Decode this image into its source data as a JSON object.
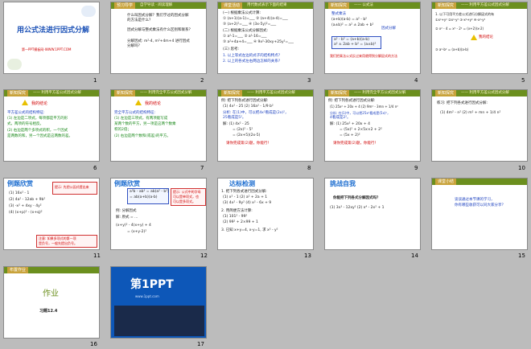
{
  "colors": {
    "accent": "#6b8f1e",
    "header_tab": "#c8a23a",
    "blue_slide": "#0d57b8",
    "title_blue": "#1f54b8",
    "red": "#d00000"
  },
  "slides": [
    {
      "num": "1",
      "title": "用公式法进行因式分解",
      "sub": "第一PPT模板网-WWW.1PPT.COM"
    },
    {
      "num": "2",
      "tab": "预习导学",
      "sub": "自学导读 · 阅读理解",
      "lines": [
        "什么叫因式分解？我们学过的因式分解",
        "的方法是什么？",
        "因式分解与整式乘法有什么区别和联系？",
        "分解因式: m²-4, m²+4m+4 进行因式",
        "分解吗？"
      ]
    },
    {
      "num": "3",
      "tab": "课堂活动",
      "sub": "用代数式表示下面的结果",
      "lines": [
        "(一) 根据乘法公式计算:",
        "① (a+1)(a-1)=___ ② (a+4)(a-4)=___",
        "③ (a+2)²=___ ④ (3x-5y)²=___",
        "(二) 根据乘法公式分解因式:",
        "① a²-1=___ ② a²-16=___",
        "③ a²+4a+4=___ ④ 9x²-30xy+25y²=___",
        "(三) 思考:",
        "1. 以上等式左边的式子的结构特点?",
        "2. 以上的各式左右两边怎样的关系?"
      ]
    },
    {
      "num": "4",
      "tab": "新知探究",
      "sub": "—— 公式法",
      "lines": [
        "整式乘法",
        "(a+b)(a-b) = a² - b²",
        "(a±b)² = a² ± 2ab + b²",
        "因式分解",
        "a² - b² = (a+b)(a-b)",
        "a² ± 2ab + b² = (a±b)²",
        "我们把乘法公式反过来用就得到分解因式的方法"
      ]
    },
    {
      "num": "5",
      "tab": "新知探究",
      "sub": "—— 利用平方差公式因式分解",
      "lines": [
        "1. 以下可用平方差公式进行分解因式的有",
        "①x²+y² ②x²-y² ③-x²+y² ④-x²-y²",
        "② x² - 4 = x² - 2² = (x+2)(x-2)",
        "③ a²-b² = (a+b)(a-b)",
        "我的结论"
      ]
    },
    {
      "num": "6",
      "tab": "新知探究",
      "sub": "—— 利用平方差公式因式分解",
      "lines": [
        "我的结论",
        "平方差公式的结构特征:",
        "(1) 左边是二项式，每项都是平方的形",
        "式，两项的符号相反。",
        "(2) 右边是两个多项式的积，一个因式",
        "是两数的和，另一个因式是这两数的差。"
      ]
    },
    {
      "num": "7",
      "tab": "新知探究",
      "sub": "—— 利用完全平方公式因式分解",
      "lines": [
        "我的结论",
        "完全平方公式的结构特征:",
        "(1) 左边是三项式，有两项能写成",
        "某两个数的平方，另一项是这两个数乘",
        "积的2倍；",
        "(2) 右边是两个数和(或差)的平方。"
      ]
    },
    {
      "num": "8",
      "tab": "新知探究",
      "sub": "—— 利用平方差公式因式分解",
      "lines": [
        "例: 把下列各式进行因式分解:",
        "(1) 4x² - 25    (2) 16a² - 1/9 b²",
        "分析: 在(1)中，可以把4x²看成是(2x)²，",
        "25看成是5²。",
        "解: (1) 4x² - 25",
        "= (2x)² - 5²",
        "= (2x+5)(2x-5)",
        "请你完成第(2)题，你能行！"
      ]
    },
    {
      "num": "9",
      "tab": "新知探究",
      "sub": "—— 利用完全平方公式因式分解",
      "lines": [
        "例: 把下列各式进行因式分解:",
        "(1) 25x² + 20x + 4   (2) 9m² - 3mn + 1/4 n²",
        "分析: 在(1)中，可以把25x²看成是(5x)²，",
        "4看成是2²。",
        "解: (1) 25x² + 20x + 4",
        "= (5x)² + 2×5x×2 + 2²",
        "= (5x + 2)²",
        "请你完成第(2)题，你能行！"
      ]
    },
    {
      "num": "10",
      "tab": "新知探究",
      "sub": "—— 利用平方差公式因式分解",
      "lines": [
        "练习: 把下列各式进行因式分解:",
        "(1) 4m² - n²    (2) m² + mn + 1/4 n²"
      ]
    },
    {
      "num": "11",
      "banner": "例题欣赏",
      "lines": [
        "(1) 16x² - 1",
        "(2) 4a² - 12ab + 9b²",
        "(3) -x² + 4xy - 4y²",
        "(4) (x+p)² - (x+q)²",
        "提示: 先把公因式提出来",
        "注意: 如果多项式的第一项",
        "是负号，一般先提出负号。"
      ]
    },
    {
      "num": "12",
      "banner": "例题欣赏",
      "lines": [
        "例: 分解因式",
        "a³b - ab³ = ab(a² - b²)",
        "= ab(a+b)(a-b)",
        "提示: 公式中的字母",
        "可以是单项式，也",
        "可以是多项式。",
        "解: 原式 = ...",
        "(x+y)² - 4(x+y) + 4",
        "= (x+y-2)²"
      ]
    },
    {
      "num": "13",
      "banner": "达标检测",
      "lines": [
        "1. 把下列各式进行因式分解:",
        "(1) x² - 1     (2) a² + 2a + 1",
        "(3) 4x² - 9y²   (4) x² - 6x + 9",
        "2. 用简便方法计算:",
        "(1) 101² - 99²",
        "(2) 99² + 2×99 + 1",
        "3. 已知 x+y=4, x-y=1, 求 x² - y²"
      ]
    },
    {
      "num": "14",
      "banner": "挑战自我",
      "lines": [
        "你能把下列各式分解因式吗？",
        "(1) 3x³ - 12xy²     (2) x⁴ - 2x² + 1"
      ]
    },
    {
      "num": "15",
      "tab": "课堂小结",
      "sub": "",
      "lines": [
        "谈谈通过本节课的学习，",
        "你有哪些收获可以同大家分享？"
      ]
    },
    {
      "num": "16",
      "tab": "布置作业",
      "heading": "作业",
      "lines": [
        "习题12.4"
      ]
    },
    {
      "num": "17",
      "logo_main": "第1PPT",
      "logo_sub": "www.1ppt.com"
    }
  ]
}
